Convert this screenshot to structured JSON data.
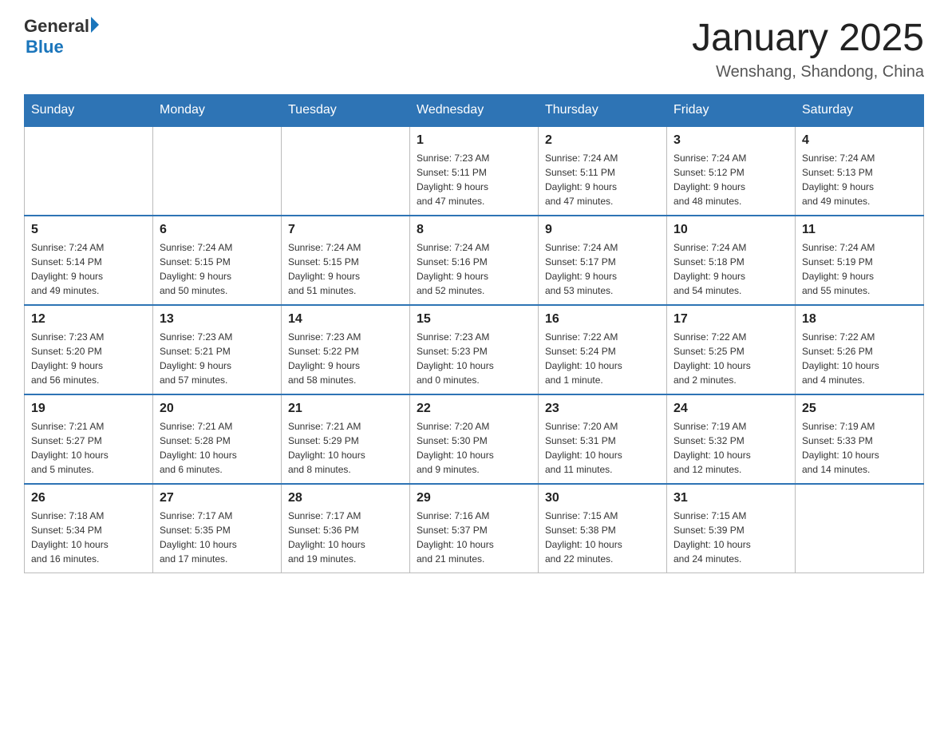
{
  "header": {
    "logo_text1": "General",
    "logo_text2": "Blue",
    "title": "January 2025",
    "subtitle": "Wenshang, Shandong, China"
  },
  "days_of_week": [
    "Sunday",
    "Monday",
    "Tuesday",
    "Wednesday",
    "Thursday",
    "Friday",
    "Saturday"
  ],
  "weeks": [
    [
      {
        "day": "",
        "info": ""
      },
      {
        "day": "",
        "info": ""
      },
      {
        "day": "",
        "info": ""
      },
      {
        "day": "1",
        "info": "Sunrise: 7:23 AM\nSunset: 5:11 PM\nDaylight: 9 hours\nand 47 minutes."
      },
      {
        "day": "2",
        "info": "Sunrise: 7:24 AM\nSunset: 5:11 PM\nDaylight: 9 hours\nand 47 minutes."
      },
      {
        "day": "3",
        "info": "Sunrise: 7:24 AM\nSunset: 5:12 PM\nDaylight: 9 hours\nand 48 minutes."
      },
      {
        "day": "4",
        "info": "Sunrise: 7:24 AM\nSunset: 5:13 PM\nDaylight: 9 hours\nand 49 minutes."
      }
    ],
    [
      {
        "day": "5",
        "info": "Sunrise: 7:24 AM\nSunset: 5:14 PM\nDaylight: 9 hours\nand 49 minutes."
      },
      {
        "day": "6",
        "info": "Sunrise: 7:24 AM\nSunset: 5:15 PM\nDaylight: 9 hours\nand 50 minutes."
      },
      {
        "day": "7",
        "info": "Sunrise: 7:24 AM\nSunset: 5:15 PM\nDaylight: 9 hours\nand 51 minutes."
      },
      {
        "day": "8",
        "info": "Sunrise: 7:24 AM\nSunset: 5:16 PM\nDaylight: 9 hours\nand 52 minutes."
      },
      {
        "day": "9",
        "info": "Sunrise: 7:24 AM\nSunset: 5:17 PM\nDaylight: 9 hours\nand 53 minutes."
      },
      {
        "day": "10",
        "info": "Sunrise: 7:24 AM\nSunset: 5:18 PM\nDaylight: 9 hours\nand 54 minutes."
      },
      {
        "day": "11",
        "info": "Sunrise: 7:24 AM\nSunset: 5:19 PM\nDaylight: 9 hours\nand 55 minutes."
      }
    ],
    [
      {
        "day": "12",
        "info": "Sunrise: 7:23 AM\nSunset: 5:20 PM\nDaylight: 9 hours\nand 56 minutes."
      },
      {
        "day": "13",
        "info": "Sunrise: 7:23 AM\nSunset: 5:21 PM\nDaylight: 9 hours\nand 57 minutes."
      },
      {
        "day": "14",
        "info": "Sunrise: 7:23 AM\nSunset: 5:22 PM\nDaylight: 9 hours\nand 58 minutes."
      },
      {
        "day": "15",
        "info": "Sunrise: 7:23 AM\nSunset: 5:23 PM\nDaylight: 10 hours\nand 0 minutes."
      },
      {
        "day": "16",
        "info": "Sunrise: 7:22 AM\nSunset: 5:24 PM\nDaylight: 10 hours\nand 1 minute."
      },
      {
        "day": "17",
        "info": "Sunrise: 7:22 AM\nSunset: 5:25 PM\nDaylight: 10 hours\nand 2 minutes."
      },
      {
        "day": "18",
        "info": "Sunrise: 7:22 AM\nSunset: 5:26 PM\nDaylight: 10 hours\nand 4 minutes."
      }
    ],
    [
      {
        "day": "19",
        "info": "Sunrise: 7:21 AM\nSunset: 5:27 PM\nDaylight: 10 hours\nand 5 minutes."
      },
      {
        "day": "20",
        "info": "Sunrise: 7:21 AM\nSunset: 5:28 PM\nDaylight: 10 hours\nand 6 minutes."
      },
      {
        "day": "21",
        "info": "Sunrise: 7:21 AM\nSunset: 5:29 PM\nDaylight: 10 hours\nand 8 minutes."
      },
      {
        "day": "22",
        "info": "Sunrise: 7:20 AM\nSunset: 5:30 PM\nDaylight: 10 hours\nand 9 minutes."
      },
      {
        "day": "23",
        "info": "Sunrise: 7:20 AM\nSunset: 5:31 PM\nDaylight: 10 hours\nand 11 minutes."
      },
      {
        "day": "24",
        "info": "Sunrise: 7:19 AM\nSunset: 5:32 PM\nDaylight: 10 hours\nand 12 minutes."
      },
      {
        "day": "25",
        "info": "Sunrise: 7:19 AM\nSunset: 5:33 PM\nDaylight: 10 hours\nand 14 minutes."
      }
    ],
    [
      {
        "day": "26",
        "info": "Sunrise: 7:18 AM\nSunset: 5:34 PM\nDaylight: 10 hours\nand 16 minutes."
      },
      {
        "day": "27",
        "info": "Sunrise: 7:17 AM\nSunset: 5:35 PM\nDaylight: 10 hours\nand 17 minutes."
      },
      {
        "day": "28",
        "info": "Sunrise: 7:17 AM\nSunset: 5:36 PM\nDaylight: 10 hours\nand 19 minutes."
      },
      {
        "day": "29",
        "info": "Sunrise: 7:16 AM\nSunset: 5:37 PM\nDaylight: 10 hours\nand 21 minutes."
      },
      {
        "day": "30",
        "info": "Sunrise: 7:15 AM\nSunset: 5:38 PM\nDaylight: 10 hours\nand 22 minutes."
      },
      {
        "day": "31",
        "info": "Sunrise: 7:15 AM\nSunset: 5:39 PM\nDaylight: 10 hours\nand 24 minutes."
      },
      {
        "day": "",
        "info": ""
      }
    ]
  ]
}
